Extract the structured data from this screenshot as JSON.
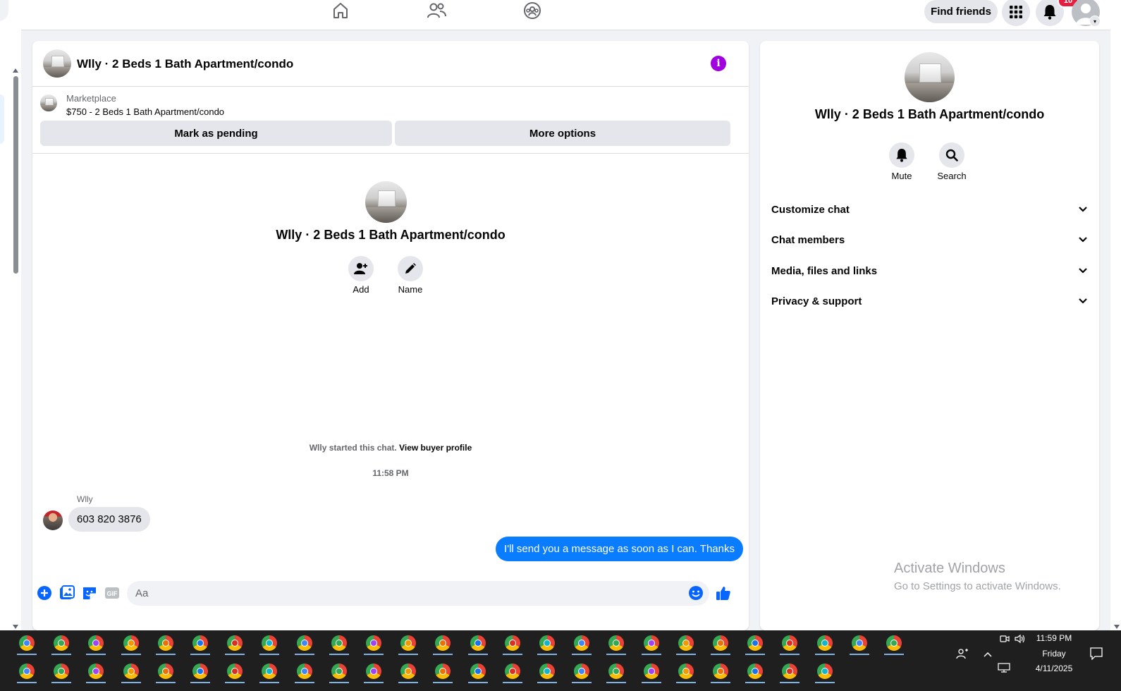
{
  "topbar": {
    "find_friends_label": "Find friends",
    "notification_count": "10"
  },
  "conversation": {
    "header_title": "Wlly · 2 Beds 1 Bath Apartment/condo",
    "marketplace_label": "Marketplace",
    "listing_summary": "$750 - 2 Beds 1 Bath Apartment/condo",
    "mark_pending_label": "Mark as pending",
    "more_options_label": "More options",
    "center_title": "Wlly · 2 Beds 1 Bath Apartment/condo",
    "add_label": "Add",
    "name_label": "Name",
    "started_text": "Wlly started this chat. ",
    "view_buyer_profile": "View buyer profile",
    "timestamp": "11:58 PM",
    "messages": [
      {
        "sender": "Wlly",
        "text": "603 820 3876",
        "direction": "incoming"
      },
      {
        "text": "I'll send you a message as soon as I can. Thanks",
        "direction": "outgoing"
      }
    ],
    "composer_placeholder": "Aa",
    "outgoing_color": "#0a7cff",
    "info_color": "#a100e0"
  },
  "details_panel": {
    "title": "Wlly · 2 Beds 1 Bath Apartment/condo",
    "mute_label": "Mute",
    "search_label": "Search",
    "sections": [
      {
        "label": "Customize chat"
      },
      {
        "label": "Chat members"
      },
      {
        "label": "Media, files and links"
      },
      {
        "label": "Privacy & support"
      }
    ]
  },
  "watermark": {
    "line1": "Activate Windows",
    "line2": "Go to Settings to activate Windows."
  },
  "taskbar": {
    "time": "11:59 PM",
    "day": "Friday",
    "date": "4/11/2025",
    "row1_apps": 26,
    "row2_apps": 24,
    "app_icon": "chrome-icon"
  }
}
